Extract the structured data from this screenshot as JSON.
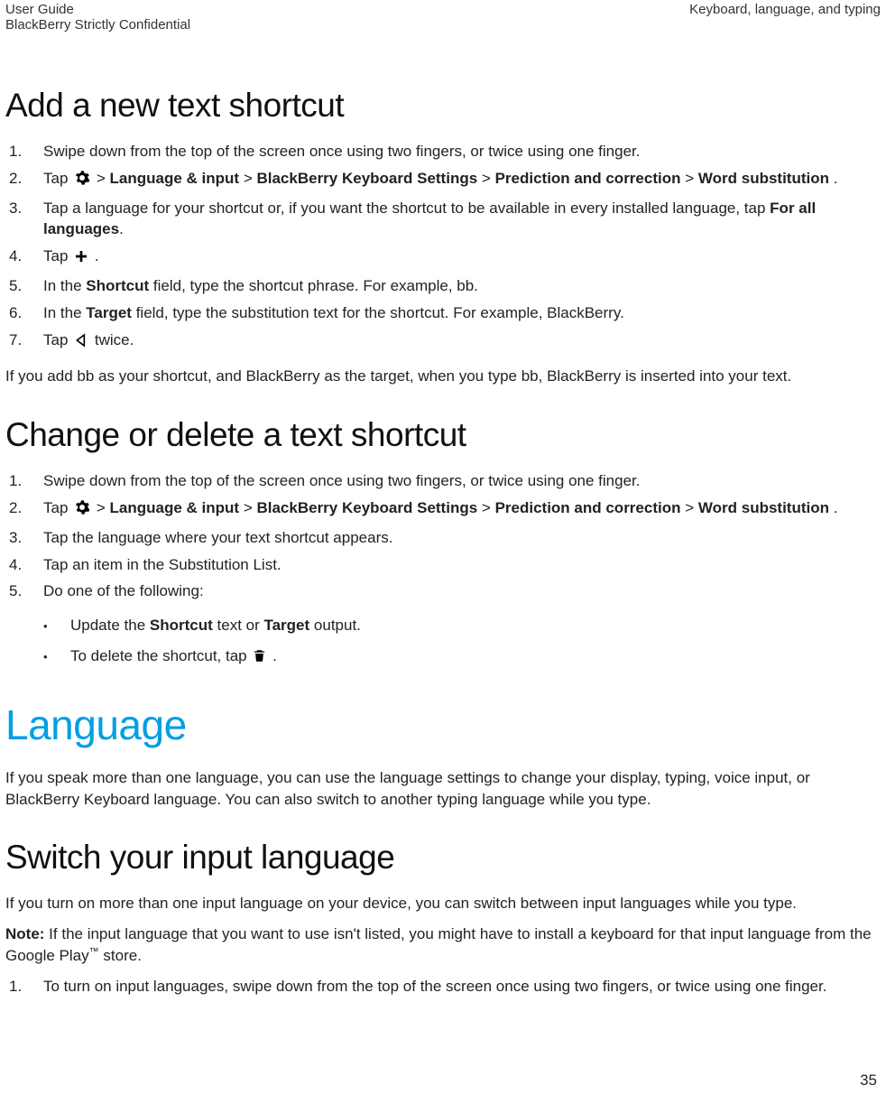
{
  "header": {
    "left_line1": "User Guide",
    "left_line2": "BlackBerry Strictly Confidential",
    "right": "Keyboard, language, and typing"
  },
  "s1": {
    "title": "Add a new text shortcut",
    "step1": "Swipe down from the top of the screen once using two fingers, or twice using one finger.",
    "step2a": "Tap ",
    "step2b": " > ",
    "step2_bold1": "Language & input",
    "step2_sep": " > ",
    "step2_bold2": "BlackBerry Keyboard Settings",
    "step2_bold3": "Prediction and correction",
    "step2_bold4": "Word substitution",
    "step2_end": ".",
    "step3a": "Tap a language for your shortcut or, if you want the shortcut to be available in every installed language, tap ",
    "step3_bold": "For all languages",
    "step3b": ".",
    "step4a": "Tap ",
    "step4b": " .",
    "step5a": "In the ",
    "step5_bold": "Shortcut",
    "step5b": " field, type the shortcut phrase. For example, bb.",
    "step6a": "In the ",
    "step6_bold": "Target",
    "step6b": " field, type the substitution text for the shortcut. For example, BlackBerry.",
    "step7a": "Tap ",
    "step7b": " twice.",
    "footer": "If you add bb as your shortcut, and BlackBerry as the target, when you type bb, BlackBerry is inserted into your text."
  },
  "s2": {
    "title": "Change or delete a text shortcut",
    "step1": "Swipe down from the top of the screen once using two fingers, or twice using one finger.",
    "step2a": "Tap ",
    "step2b": " > ",
    "step2_bold1": "Language & input",
    "step2_sep": " > ",
    "step2_bold2": "BlackBerry Keyboard Settings",
    "step2_bold3": "Prediction and correction",
    "step2_bold4": "Word substitution",
    "step2_end": ".",
    "step3": "Tap the language where your text shortcut appears.",
    "step4": "Tap an item in the Substitution List.",
    "step5": "Do one of the following:",
    "b1a": " Update the ",
    "b1_bold1": "Shortcut",
    "b1b": " text or ",
    "b1_bold2": "Target",
    "b1c": " output.",
    "b2a": "To delete the shortcut, tap ",
    "b2b": " ."
  },
  "s3": {
    "title": "Language",
    "p1": "If you speak more than one language, you can use the language settings to change your display, typing, voice input, or BlackBerry Keyboard language. You can also switch to another typing language while you type."
  },
  "s4": {
    "title": "Switch your input language",
    "p1": "If you turn on more than one input language on your device, you can switch between input languages while you type.",
    "note_label": "Note:",
    "note_a": " If the input language that you want to use isn't listed, you might have to install a keyboard for that input language from the Google Play",
    "note_tm": "™",
    "note_b": " store.",
    "step1": "To turn on input languages, swipe down from the top of the screen once using two fingers, or twice using one finger."
  },
  "page_number": "35",
  "nums": {
    "n1": "1.",
    "n2": "2.",
    "n3": "3.",
    "n4": "4.",
    "n5": "5.",
    "n6": "6.",
    "n7": "7."
  },
  "bullet": "•"
}
